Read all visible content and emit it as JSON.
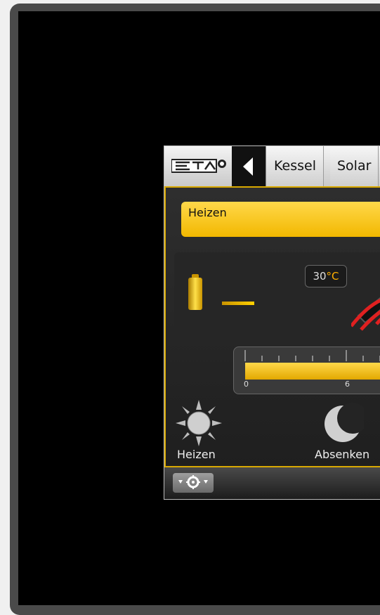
{
  "navbar": {
    "logo_text": "ETA",
    "back_icon": "chevron-left-icon",
    "tabs": [
      {
        "label": "Kessel"
      },
      {
        "label": "Solar"
      }
    ]
  },
  "status": {
    "text": "Heizen"
  },
  "temperature": {
    "value": "30",
    "unit": "°C"
  },
  "scale": {
    "labels": [
      "0",
      "6"
    ]
  },
  "modes": [
    {
      "label": "Heizen",
      "icon": "sun-icon"
    },
    {
      "label": "Absenken",
      "icon": "moon-icon"
    }
  ],
  "footer": {
    "settings_icon": "settings-icon"
  },
  "colors": {
    "accent": "#f2b800",
    "panel_bg": "#2b2b2b"
  }
}
